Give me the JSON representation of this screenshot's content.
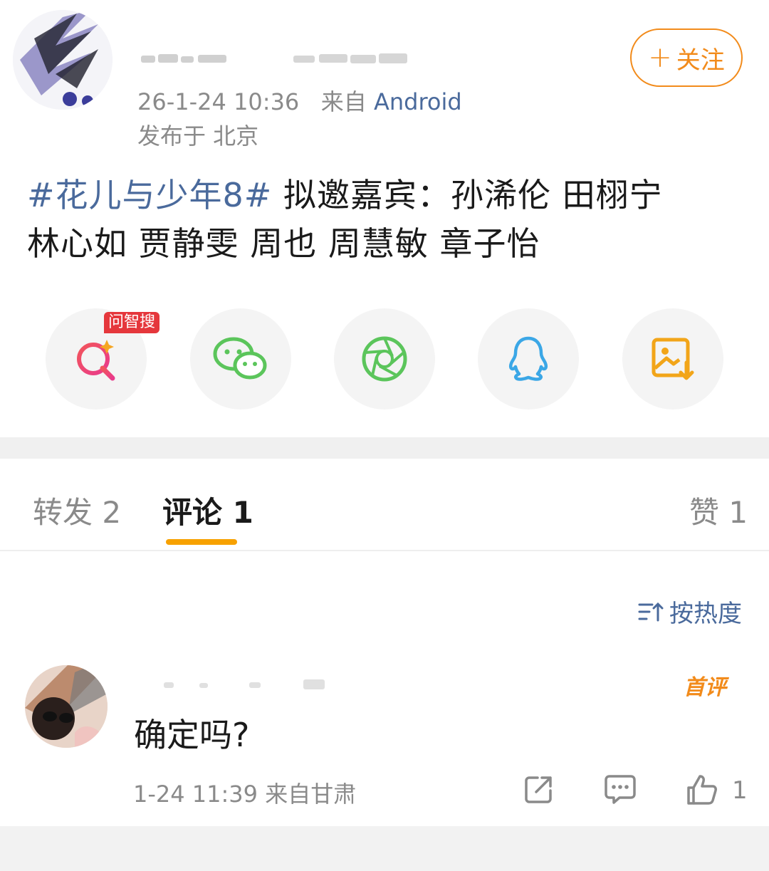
{
  "post": {
    "follow_label": "关注",
    "follow_plus": "+",
    "time": "26-1-24 10:36",
    "source_prefix": "来自",
    "source": "Android",
    "location": "发布于 北京",
    "topic": "#花儿与少年8#",
    "text_line1": "拟邀嘉宾：孙浠伦 田栩宁",
    "text_line2": "林心如 贾静雯 周也 周慧敏 章子怡"
  },
  "share": {
    "badge": "问智搜",
    "items": [
      {
        "icon": "ai-search-icon",
        "color": "#f04d4d"
      },
      {
        "icon": "wechat-icon",
        "color": "#5bc55b"
      },
      {
        "icon": "moments-icon",
        "color": "#5bc55b"
      },
      {
        "icon": "qq-icon",
        "color": "#3ba7e6"
      },
      {
        "icon": "save-image-icon",
        "color": "#f2a519"
      }
    ]
  },
  "tabs": {
    "repost": "转发 2",
    "comment": "评论 1",
    "like": "赞 1"
  },
  "sort_label": "按热度",
  "comment": {
    "badge": "首评",
    "text": "确定吗?",
    "meta": "1-24 11:39  来自甘肃",
    "like_count": "1"
  },
  "colors": {
    "accent_orange": "#f28b1b",
    "link_blue": "#4a6a9c",
    "tab_underline": "#f7a100"
  }
}
